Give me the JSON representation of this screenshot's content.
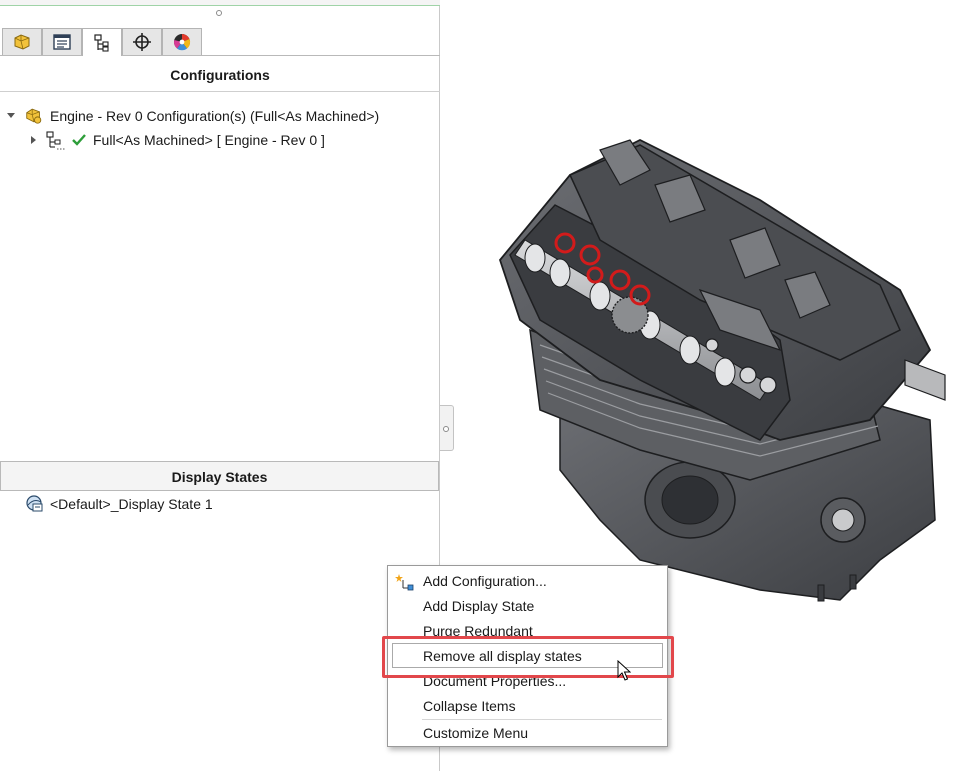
{
  "window": {
    "tabs": [
      {
        "name": "feature-manager",
        "icon": "feature-manager-icon"
      },
      {
        "name": "property-manager",
        "icon": "property-manager-icon"
      },
      {
        "name": "configuration-manager",
        "icon": "configuration-manager-icon",
        "active": true
      },
      {
        "name": "dimxpert-manager",
        "icon": "dimxpert-manager-icon"
      },
      {
        "name": "display-manager",
        "icon": "display-manager-icon"
      }
    ]
  },
  "configurations": {
    "header": "Configurations",
    "root_label": "Engine - Rev 0 Configuration(s)  (Full<As Machined>)",
    "child_label": "Full<As Machined> [ Engine - Rev 0 ]"
  },
  "display_states": {
    "header": "Display States",
    "items": [
      "<Default>_Display State 1"
    ]
  },
  "context_menu": {
    "items": [
      {
        "label": "Add Configuration...",
        "icon": "add-configuration-icon"
      },
      {
        "label": "Add Display State"
      },
      {
        "label": "Purge Redundant"
      },
      {
        "label": "Remove all display states",
        "hovered": true
      },
      {
        "label": "Document Properties..."
      },
      {
        "label": "Collapse Items"
      },
      {
        "label": "Customize Menu"
      }
    ]
  },
  "colors": {
    "highlight": "#e2474b",
    "active_check": "#2e9e3a",
    "engine_body": "#55575b",
    "valve_springs": "#d21b1b"
  },
  "viewport": {
    "model": "engine-assembly"
  }
}
